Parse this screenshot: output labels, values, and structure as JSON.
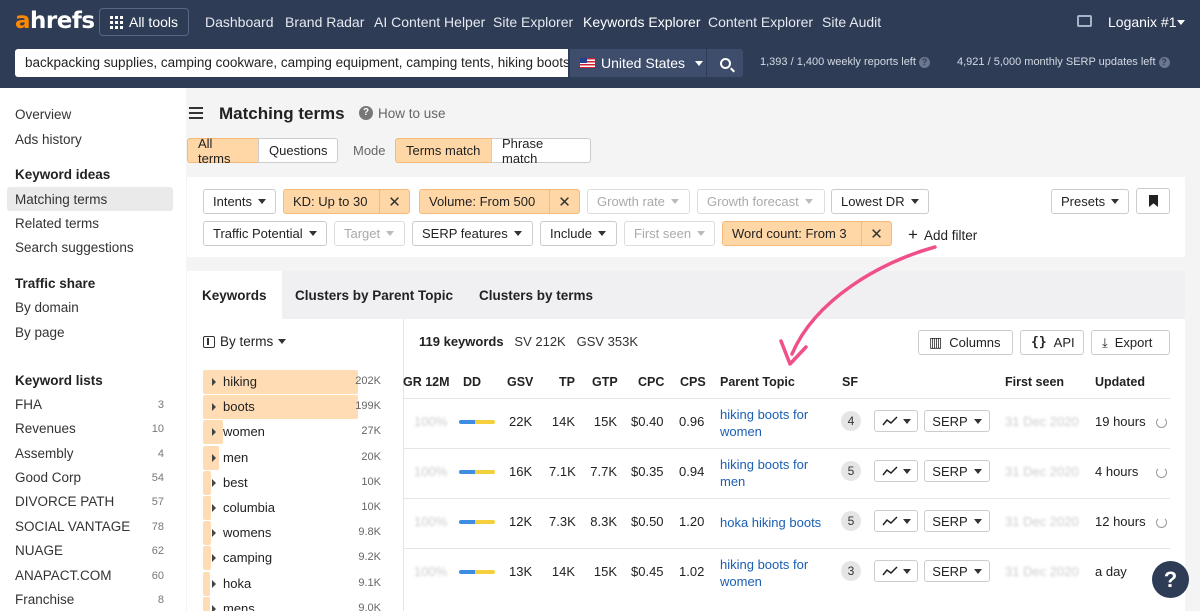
{
  "header": {
    "logo_a": "a",
    "logo_rest": "hrefs",
    "all_tools": "All tools",
    "nav": [
      "Dashboard",
      "Brand Radar",
      "AI Content Helper",
      "Site Explorer",
      "Keywords Explorer",
      "Content Explorer",
      "Site Audit"
    ],
    "active_nav": "Keywords Explorer",
    "user": "Loganix #1",
    "search_value": "backpacking supplies, camping cookware, camping equipment, camping tents, hiking boots, h",
    "country": "United States",
    "weekly_quota": "1,393  /  1,400  weekly reports left",
    "monthly_quota": "4,921  /  5,000  monthly SERP updates left"
  },
  "sidebar": {
    "top": [
      "Overview",
      "Ads history"
    ],
    "ideas_heading": "Keyword ideas",
    "ideas": [
      "Matching terms",
      "Related terms",
      "Search suggestions"
    ],
    "active": "Matching terms",
    "traffic_heading": "Traffic share",
    "traffic": [
      "By domain",
      "By page"
    ],
    "lists_heading": "Keyword lists",
    "lists": [
      {
        "name": "FHA",
        "count": "3"
      },
      {
        "name": "Revenues",
        "count": "10"
      },
      {
        "name": "Assembly",
        "count": "4"
      },
      {
        "name": "Good Corp",
        "count": "54"
      },
      {
        "name": "DIVORCE PATH",
        "count": "57"
      },
      {
        "name": "SOCIAL VANTAGE",
        "count": "78"
      },
      {
        "name": "NUAGE",
        "count": "62"
      },
      {
        "name": "ANAPACT.COM",
        "count": "60"
      },
      {
        "name": "Franchise",
        "count": "8"
      }
    ]
  },
  "page": {
    "title": "Matching terms",
    "how_to": "How to use",
    "toggles": {
      "all_terms": "All terms",
      "questions": "Questions",
      "mode": "Mode",
      "terms_match": "Terms match",
      "phrase_match": "Phrase match"
    }
  },
  "filters": {
    "intents": "Intents",
    "kd": "KD: Up to 30",
    "volume": "Volume: From 500",
    "growth_rate": "Growth rate",
    "growth_forecast": "Growth forecast",
    "lowest_dr": "Lowest DR",
    "presets": "Presets",
    "traffic_potential": "Traffic Potential",
    "target": "Target",
    "serp_features": "SERP features",
    "include": "Include",
    "first_seen": "First seen",
    "word_count": "Word count: From 3",
    "add_filter": "Add filter"
  },
  "tabs": [
    "Keywords",
    "Clusters by Parent Topic",
    "Clusters by terms"
  ],
  "terms_panel": {
    "by_terms": "By terms",
    "terms": [
      {
        "label": "hiking",
        "count": "202K",
        "share": 1.0,
        "selected": true
      },
      {
        "label": "boots",
        "count": "199K",
        "share": 0.985,
        "selected": true
      },
      {
        "label": "women",
        "count": "27K",
        "share": 0.13
      },
      {
        "label": "men",
        "count": "20K",
        "share": 0.1
      },
      {
        "label": "best",
        "count": "10K",
        "share": 0.05
      },
      {
        "label": "columbia",
        "count": "10K",
        "share": 0.05
      },
      {
        "label": "womens",
        "count": "9.8K",
        "share": 0.05
      },
      {
        "label": "camping",
        "count": "9.2K",
        "share": 0.05
      },
      {
        "label": "hoka",
        "count": "9.1K",
        "share": 0.045
      },
      {
        "label": "mens",
        "count": "9.0K",
        "share": 0.045
      }
    ]
  },
  "table": {
    "summary_count": "119 keywords",
    "summary_sv": "SV 212K",
    "summary_gsv": "GSV 353K",
    "columns_btn": "Columns",
    "api_btn": "API",
    "export_btn": "Export",
    "headers": [
      "GR 12M",
      "DD",
      "GSV",
      "TP",
      "GTP",
      "CPC",
      "CPS",
      "Parent Topic",
      "SF",
      "First seen",
      "Updated"
    ],
    "serp_label": "SERP",
    "rows": [
      {
        "gr": "100%",
        "gsv": "22K",
        "tp": "14K",
        "gtp": "15K",
        "cpc": "$0.40",
        "cps": "0.96",
        "parent": "hiking boots for women",
        "sf": "4",
        "first_seen": "31 Dec 2020",
        "updated": "19 hours"
      },
      {
        "gr": "100%",
        "gsv": "16K",
        "tp": "7.1K",
        "gtp": "7.7K",
        "cpc": "$0.35",
        "cps": "0.94",
        "parent": "hiking boots for men",
        "sf": "5",
        "first_seen": "31 Dec 2020",
        "updated": "4 hours"
      },
      {
        "gr": "100%",
        "gsv": "12K",
        "tp": "7.3K",
        "gtp": "8.3K",
        "cpc": "$0.50",
        "cps": "1.20",
        "parent": "hoka hiking boots",
        "sf": "5",
        "first_seen": "31 Dec 2020",
        "updated": "12 hours"
      },
      {
        "gr": "100%",
        "gsv": "13K",
        "tp": "14K",
        "gtp": "15K",
        "cpc": "$0.45",
        "cps": "1.02",
        "parent": "hiking boots for women",
        "sf": "3",
        "first_seen": "31 Dec 2020",
        "updated": "a day"
      }
    ]
  },
  "colors": {
    "header_bg": "#2e3c56",
    "accent_orange": "#ff8800",
    "filter_active": "#ffd7a6",
    "annotation_arrow": "#ef4f8a",
    "link": "#1a5fb4"
  }
}
